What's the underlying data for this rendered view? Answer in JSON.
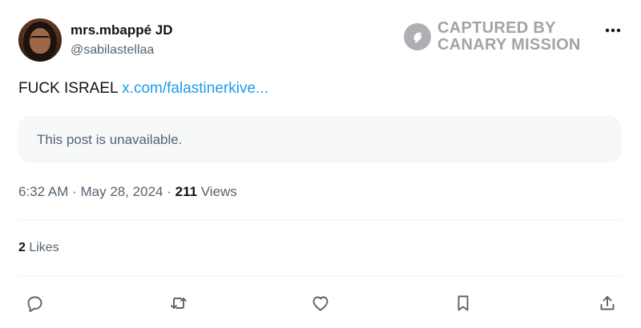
{
  "author": {
    "display_name": "mrs.mbappé JD",
    "handle": "@sabilastellaa"
  },
  "watermark": {
    "line1": "CAPTURED BY",
    "line2": "CANARY MISSION"
  },
  "post": {
    "text": "FUCK ISRAEL ",
    "link_text": "x.com/falastinerkive..."
  },
  "quoted_post": {
    "text": "This post is unavailable."
  },
  "meta": {
    "time": "6:32 AM",
    "separator1": " · ",
    "date": "May 28, 2024",
    "separator2": " · ",
    "views_count": "211",
    "views_label": " Views"
  },
  "engagement": {
    "likes_count": "2",
    "likes_label": " Likes"
  },
  "actions": {
    "icons": [
      "reply-icon",
      "repost-icon",
      "like-icon",
      "bookmark-icon",
      "share-icon"
    ]
  },
  "colors": {
    "link": "#1d9bf0",
    "secondary_text": "#536471",
    "primary_text": "#0f1419",
    "border": "#eff3f4"
  }
}
